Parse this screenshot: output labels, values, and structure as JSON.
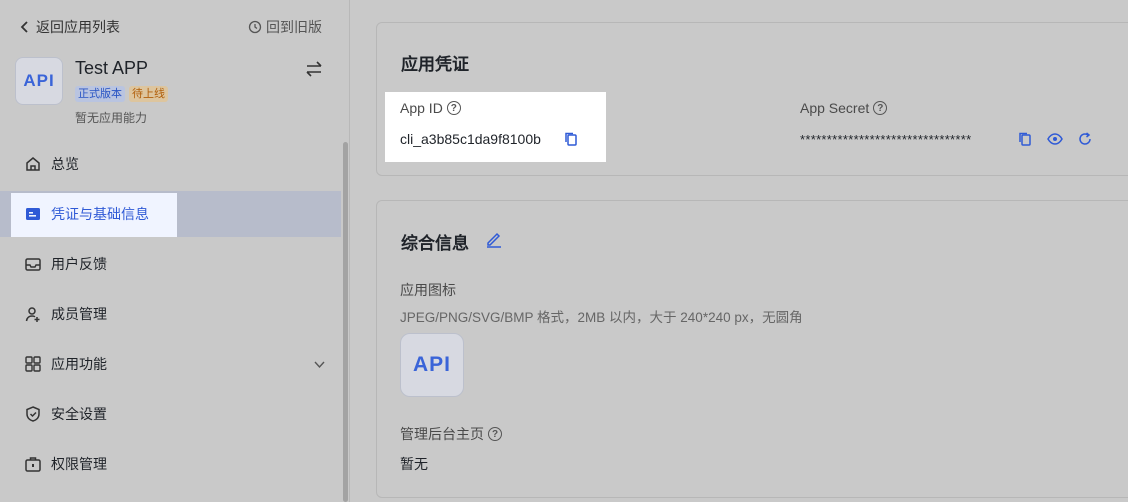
{
  "sidebar": {
    "back_label": "返回应用列表",
    "old_version_label": "回到旧版",
    "app": {
      "avatar_text": "API",
      "name": "Test APP",
      "badges": [
        "正式版本",
        "待上线"
      ],
      "description": "暂无应用能力"
    },
    "nav": [
      {
        "label": "总览",
        "icon": "home-icon"
      },
      {
        "label": "凭证与基础信息",
        "icon": "credential-icon",
        "active": true
      },
      {
        "label": "用户反馈",
        "icon": "mail-icon"
      },
      {
        "label": "成员管理",
        "icon": "user-add-icon"
      },
      {
        "label": "应用功能",
        "icon": "grid-icon",
        "expandable": true
      },
      {
        "label": "安全设置",
        "icon": "shield-icon"
      },
      {
        "label": "权限管理",
        "icon": "briefcase-icon"
      }
    ]
  },
  "credentials": {
    "title": "应用凭证",
    "app_id_label": "App ID",
    "app_id_value": "cli_a3b85c1da9f8100b",
    "app_secret_label": "App Secret",
    "app_secret_value": "********************************"
  },
  "general": {
    "title": "综合信息",
    "icon_label": "应用图标",
    "icon_hint": "JPEG/PNG/SVG/BMP 格式，2MB 以内，大于 240*240 px，无圆角",
    "icon_text": "API",
    "admin_home_label": "管理后台主页",
    "admin_home_value": "暂无"
  },
  "colors": {
    "accent": "#2f5ad6",
    "active_bg": "#f0f4ff"
  }
}
